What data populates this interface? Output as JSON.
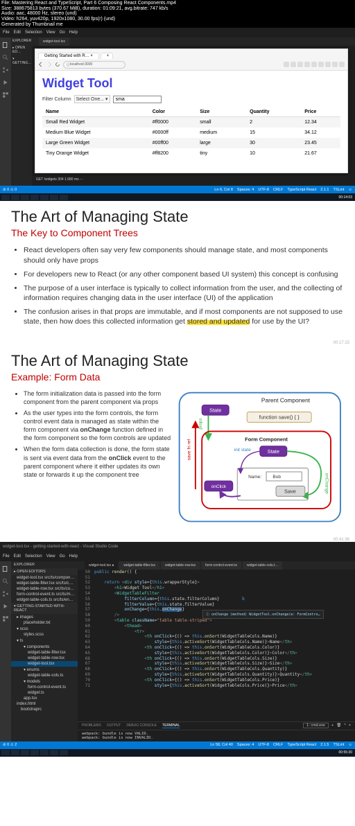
{
  "media_info": {
    "file": "File: Mastering React and TypeScript, Part 6 Composing React Components.mp4",
    "size": "Size: 388675813 bytes (370.67 MiB), duration: 01:09:21, avg.bitrate: 747 kb/s",
    "audio": "Audio: aac, 48000 Hz, stereo (und)",
    "video": "Video: h264, yuv420p, 1920x1080, 30.00 fps(r) (und)",
    "gen": "Generated by Thumbnail me"
  },
  "vscode1": {
    "menu": [
      "File",
      "Edit",
      "Selection",
      "View",
      "Go",
      "Help"
    ],
    "tabs": [
      "widget-tool.tsx"
    ],
    "browser": {
      "tab": "Getting Started with R…",
      "addr": "localhost:3000"
    },
    "widget": {
      "title": "Widget Tool",
      "filter_label": "Filter Column",
      "filter_select": "Select One... ▾",
      "filter_value": "sma",
      "cols": [
        "Name",
        "Color",
        "Size",
        "Quantity",
        "Price"
      ],
      "rows": [
        {
          "name": "Small Red Widget",
          "color": "#ff0000",
          "size": "small",
          "qty": "2",
          "price": "12.34"
        },
        {
          "name": "Medium Blue Widget",
          "color": "#0000ff",
          "size": "medium",
          "qty": "15",
          "price": "34.12"
        },
        {
          "name": "Large Green Widget",
          "color": "#00ff00",
          "size": "large",
          "qty": "30",
          "price": "23.45"
        },
        {
          "name": "Tiny Orange Widget",
          "color": "#ff8200",
          "size": "tiny",
          "qty": "10",
          "price": "21.67"
        }
      ]
    },
    "console": "GET /widgets 304 1.680 ms - -",
    "status": {
      "left": "⊘ 0 ⚠ 0",
      "right": [
        "Ln 6, Col 8",
        "Spaces: 4",
        "UTF-8",
        "CRLF",
        "TypeScript React",
        "2.1.1",
        "TSLint",
        "☺"
      ]
    },
    "clock": "00:14:03"
  },
  "slide1": {
    "title": "The Art of Managing State",
    "subtitle": "The Key to Component Trees",
    "items": [
      "React developers often say very few components should manage state, and most components should only have props",
      "For developers new to React (or any other component based UI system) this concept is confusing",
      "The purpose of a user interface is typically to collect information from the user, and the collecting of information requires changing data in the user interface (UI) of the application",
      "The confusion arises in that props are immutable, and if most components are not supposed to use state, then how does this collected information get "
    ],
    "hl_pre": "stored and updated",
    "hl_post": " for use by the UI?",
    "ts": "00:17:15"
  },
  "slide2": {
    "title": "The Art of Managing State",
    "subtitle": "Example: Form Data",
    "items": [
      "The form initialization data is passed into the form component from the parent component via props",
      "As the user types into the form controls, the form control event data is managed as state within the form component via <b>onChange</b> function defined in the form component so the form controls are updated",
      "When the form data collection is done, the form state is sent via event data from the <b>onClick</b> event to the parent component where it either updates its own state or forwards it up the component tree"
    ],
    "diagram": {
      "parent": "Parent Component",
      "form": "Form Component",
      "state": "State",
      "func": "function save() { }",
      "init": "init state",
      "name_lbl": "Name:",
      "name_val": "Bob",
      "save": "Save",
      "onclick": "onClick",
      "onchange": "onChange",
      "props": "props",
      "savefn": "save fn ref"
    },
    "ts": "00:41:36"
  },
  "vscode2": {
    "title": "widget-tool.tsx - getting-started-with-react - Visual Studio Code",
    "explorer_hdr": "EXPLORER",
    "open_editors": "OPEN EDITORS",
    "open": [
      "widget-tool.tsx src/ts/components",
      "widget-table-filter.tsx src/ts/comp...",
      "widget-table-row.tsx src/ts/compon...",
      "form-control-event.ts src/ts/models",
      "widget-table-cols.ts src/ts/enums"
    ],
    "proj": "GETTING-STARTED-WITH-REACT",
    "tree": [
      {
        "d": 1,
        "t": "▸ images"
      },
      {
        "d": 2,
        "t": "placeholder.txt"
      },
      {
        "d": 1,
        "t": "▾ scss"
      },
      {
        "d": 2,
        "t": "styles.scss"
      },
      {
        "d": 1,
        "t": "▾ ts"
      },
      {
        "d": 2,
        "t": "▾ components"
      },
      {
        "d": 3,
        "t": "widget-table-filter.tsx"
      },
      {
        "d": 3,
        "t": "widget-table-row.tsx"
      },
      {
        "d": 3,
        "t": "widget-tool.tsx",
        "sel": true
      },
      {
        "d": 2,
        "t": "▾ enums"
      },
      {
        "d": 3,
        "t": "widget-table-cols.ts"
      },
      {
        "d": 2,
        "t": "▾ models"
      },
      {
        "d": 3,
        "t": "form-control-event.ts"
      },
      {
        "d": 3,
        "t": "widget.ts"
      },
      {
        "d": 2,
        "t": "app.tsx"
      },
      {
        "d": 1,
        "t": "index.html"
      },
      {
        "d": 0,
        "t": "bootstraprc"
      }
    ],
    "tabs": [
      "widget-tool.tsx",
      "widget-table-filter.tsx",
      "widget-table-row.tsx",
      "form-control-event.ts",
      "widget-table-cols.t…"
    ],
    "code_start": 50,
    "terminal": {
      "tabs": [
        "PROBLEMS",
        "OUTPUT",
        "DEBUG CONSOLE",
        "TERMINAL"
      ],
      "sel": "1: cmd.exe",
      "lines": [
        "webpack: bundle is now VALID.",
        "webpack: bundle is now INVALID."
      ]
    },
    "status": {
      "left": "⊘ 0 ⚠ 2",
      "right": [
        "Ln 58, Col 40",
        "Spaces: 4",
        "UTF-8",
        "CRLF",
        "TypeScript React",
        "2.1.5",
        "TSLint",
        "☺"
      ]
    },
    "clock": "00:55:30",
    "tooltip": "ⓘ onChange  (method) WidgetTool.onChange(e: FormContro…"
  }
}
